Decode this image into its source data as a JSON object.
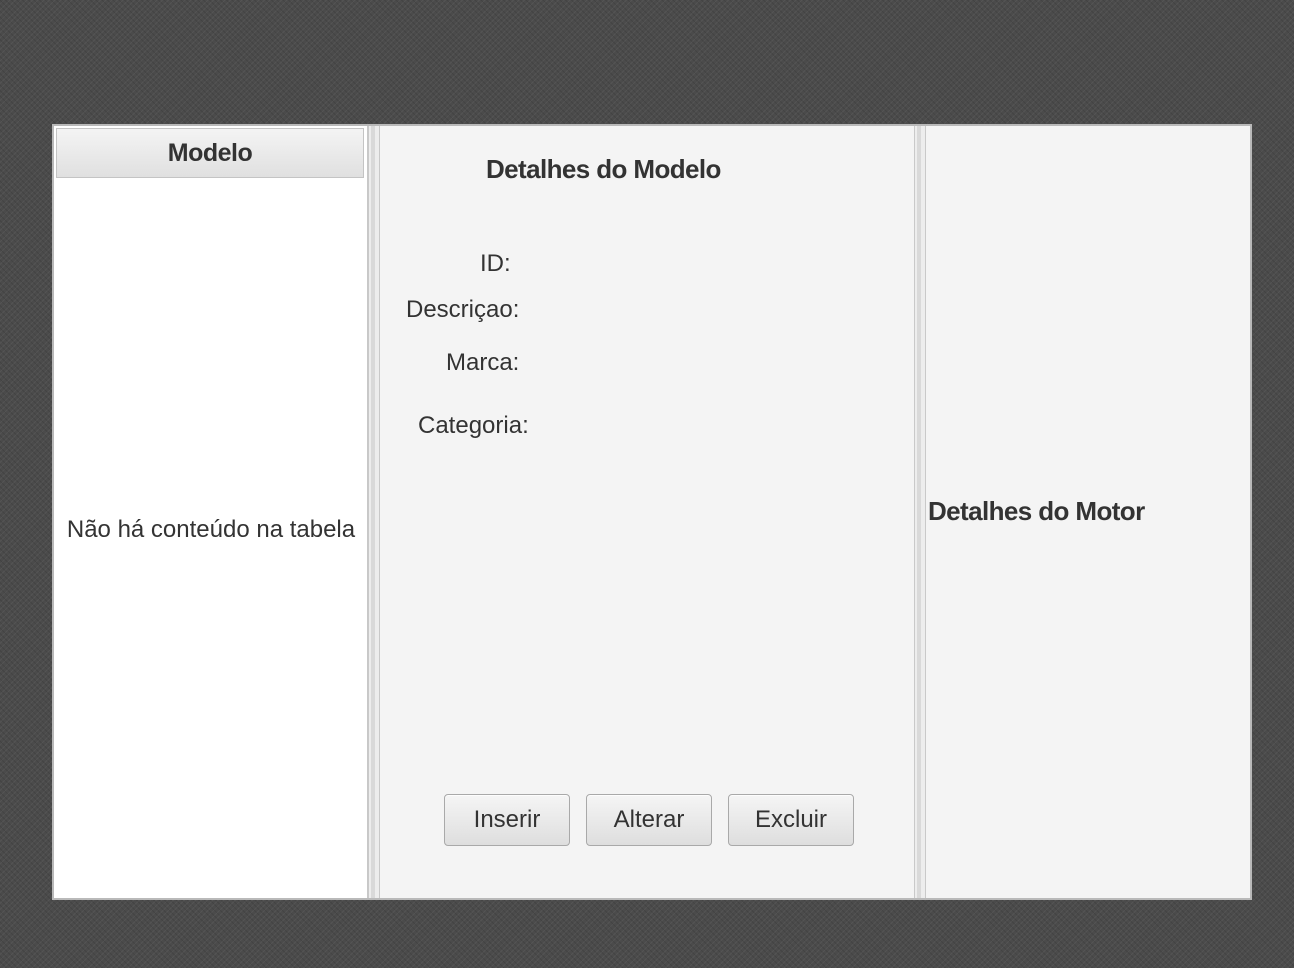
{
  "table": {
    "column_header": "Modelo",
    "empty_placeholder": "Não há conteúdo na tabela"
  },
  "detail": {
    "title": "Detalhes do Modelo",
    "labels": {
      "id": "ID:",
      "descricao": "Descriçao:",
      "marca": "Marca:",
      "categoria": "Categoria:"
    },
    "buttons": {
      "insert": "Inserir",
      "alter": "Alterar",
      "delete": "Excluir"
    }
  },
  "motor": {
    "title": "Detalhes do Motor"
  }
}
